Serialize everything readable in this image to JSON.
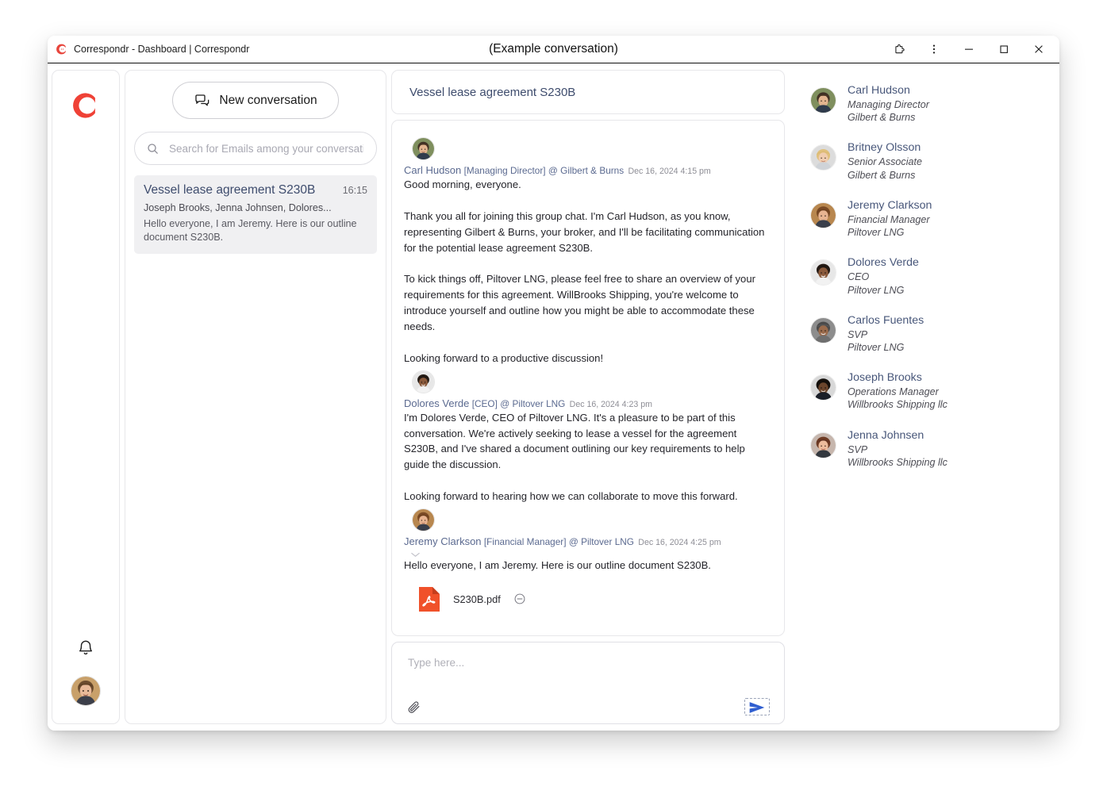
{
  "window": {
    "app_icon": "correspondr-logo-icon",
    "title": "Correspondr - Dashboard | Correspondr",
    "center_label": "(Example conversation)",
    "controls": {
      "extensions": "puzzle-piece-icon",
      "menu": "three-dot-menu-icon",
      "minimize": "minimize-icon",
      "maximize": "maximize-icon",
      "close": "close-icon"
    }
  },
  "left_rail": {
    "logo": "correspondr-logo-icon",
    "notifications": "bell-icon",
    "avatar": "user-avatar"
  },
  "conversations_panel": {
    "new_conversation_label": "New conversation",
    "new_conversation_icon": "chat-bubbles-icon",
    "search": {
      "icon": "search-icon",
      "placeholder": "Search for Emails among your conversations",
      "value": ""
    },
    "items": [
      {
        "title": "Vessel lease agreement S230B",
        "time": "16:15",
        "people": "Joseph Brooks, Jenna Johnsen, Dolores...",
        "preview": "Hello everyone, I am Jeremy. Here is our outline document S230B.",
        "selected": true
      }
    ]
  },
  "thread": {
    "header_title": "Vessel lease agreement S230B",
    "messages": [
      {
        "sender": "Carl Hudson",
        "role": "[Managing Director]",
        "org": "@ Gilbert & Burns",
        "date": "Dec 16, 2024 4:15 pm",
        "body": "Good morning, everyone.\n\nThank you all for joining this group chat. I'm Carl Hudson, as you know, representing Gilbert & Burns, your broker, and I'll be facilitating communication for the potential lease agreement S230B.\n\nTo kick things off, Piltover LNG, please feel free to share an overview of your requirements for this agreement. WillBrooks Shipping, you're welcome to introduce yourself and outline how you might be able to accommodate these needs.\n\nLooking forward to a productive discussion!",
        "has_chevron": false,
        "attachment": null
      },
      {
        "sender": "Dolores Verde",
        "role": "[CEO]",
        "org": "@ Piltover LNG",
        "date": "Dec 16, 2024 4:23 pm",
        "body": "I'm Dolores Verde, CEO of Piltover LNG. It's a pleasure to be part of this conversation. We're actively seeking to lease a vessel for the agreement S230B, and I've shared a document outlining our key requirements to help guide the discussion.\n\nLooking forward to hearing how we can collaborate to move this forward.",
        "has_chevron": false,
        "attachment": null
      },
      {
        "sender": "Jeremy Clarkson",
        "role": "[Financial Manager]",
        "org": "@ Piltover LNG",
        "date": "Dec 16, 2024 4:25 pm",
        "body": "Hello everyone, I am Jeremy. Here is our outline document S230B.",
        "has_chevron": true,
        "attachment": {
          "icon": "pdf-file-icon",
          "name": "S230B.pdf",
          "remove_icon": "remove-circle-icon"
        }
      }
    ]
  },
  "composer": {
    "placeholder": "Type here...",
    "value": "",
    "attach_icon": "paperclip-icon",
    "send_icon": "send-paper-plane-icon"
  },
  "participants": [
    {
      "name": "Carl Hudson",
      "role": "Managing Director",
      "org": "Gilbert & Burns"
    },
    {
      "name": "Britney Olsson",
      "role": "Senior Associate",
      "org": "Gilbert & Burns"
    },
    {
      "name": "Jeremy Clarkson",
      "role": "Financial Manager",
      "org": "Piltover LNG"
    },
    {
      "name": "Dolores Verde",
      "role": "CEO",
      "org": "Piltover LNG"
    },
    {
      "name": "Carlos Fuentes",
      "role": "SVP",
      "org": "Piltover LNG"
    },
    {
      "name": "Joseph Brooks",
      "role": "Operations Manager",
      "org": "Willbrooks Shipping llc"
    },
    {
      "name": "Jenna Johnsen",
      "role": "SVP",
      "org": "Willbrooks Shipping llc"
    }
  ],
  "colors": {
    "brand_red": "#e8453c",
    "link_blue": "#48577a",
    "accent_blue": "#2f5ed0",
    "pdf_orange": "#f0512a",
    "selected_row": "#f0f0f2"
  }
}
